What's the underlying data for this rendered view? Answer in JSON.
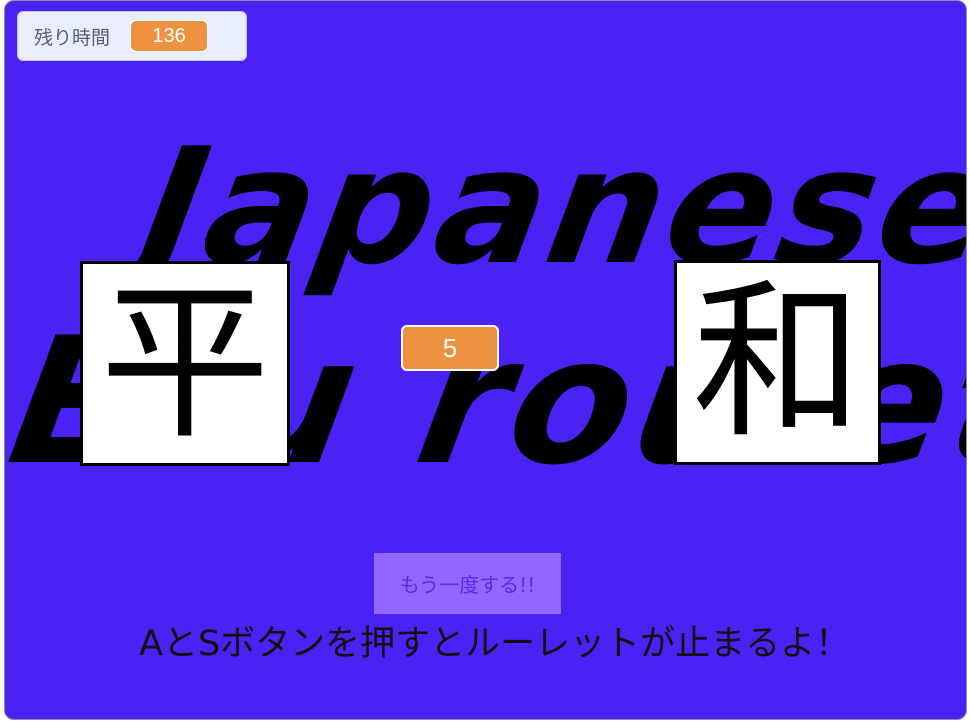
{
  "timer": {
    "label": "残り時間",
    "value": "136"
  },
  "title": {
    "line1": "Japanese",
    "line2": "Eru roulette"
  },
  "cards": {
    "left": "平",
    "right": "和"
  },
  "counter": {
    "value": "5"
  },
  "retry": {
    "label": "もう一度する!!"
  },
  "instruction": {
    "text": "AとSボタンを押すとルーレットが止まるよ！"
  },
  "colors": {
    "stage": "#4b22f4",
    "accent": "#ec9240",
    "button": "#9266ff"
  }
}
